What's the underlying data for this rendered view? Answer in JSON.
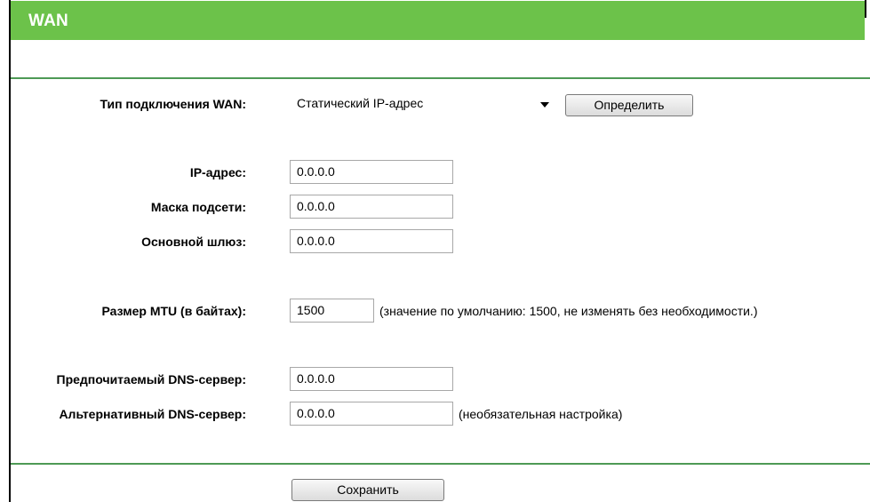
{
  "header": {
    "title": "WAN"
  },
  "connection_type": {
    "label": "Тип подключения WAN:",
    "selected": "Статический IP-адрес",
    "detect_button": "Определить"
  },
  "ip_address": {
    "label": "IP-адрес:",
    "value": "0.0.0.0"
  },
  "subnet_mask": {
    "label": "Маска подсети:",
    "value": "0.0.0.0"
  },
  "gateway": {
    "label": "Основной шлюз:",
    "value": "0.0.0.0"
  },
  "mtu": {
    "label": "Размер MTU (в байтах):",
    "value": "1500",
    "note": "(значение по умолчанию: 1500, не изменять без необходимости.)"
  },
  "dns_primary": {
    "label": "Предпочитаемый DNS-сервер:",
    "value": "0.0.0.0"
  },
  "dns_secondary": {
    "label": "Альтернативный DNS-сервер:",
    "value": "0.0.0.0",
    "note": "(необязательная настройка)"
  },
  "save_button": "Сохранить",
  "colors": {
    "header": "#6cc24a",
    "divider": "#4e9a55"
  }
}
